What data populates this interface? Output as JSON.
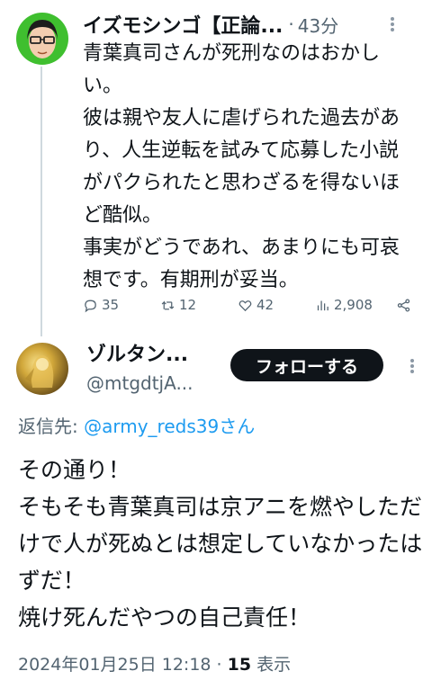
{
  "tweet1": {
    "author_name": "イズモシンゴ【正論...",
    "separator": "·",
    "time": "43分",
    "body": "青葉真司さんが死刑なのはおかしい。\n彼は親や友人に虐げられた過去があり、人生逆転を試みて応募した小説がパクられたと思わざるを得ないほど酷似。\n事実がどうであれ、あまりにも可哀想です。有期刑が妥当。",
    "replies": "35",
    "reposts": "12",
    "likes": "42",
    "views": "2,908"
  },
  "tweet2": {
    "author_name": "ゾルタン...",
    "handle": "@mtgdtjA...",
    "follow_label": "フォローする",
    "reply_prefix": "返信先: ",
    "reply_mention": "@army_reds39さん",
    "body": "その通り！\nそもそも青葉真司は京アニを燃やしただけで人が死ぬとは想定していなかったはずだ！\n焼け死んだやつの自己責任！",
    "date": "2024年01月25日 12:18",
    "separator": " · ",
    "views_count": "15",
    "views_label": " 表示"
  },
  "icons": {
    "reply": "reply-icon",
    "repost": "repost-icon",
    "like": "heart-icon",
    "views": "views-icon",
    "share": "share-icon",
    "more": "more-icon"
  },
  "colors": {
    "text": "#0f1419",
    "secondary": "#536471",
    "link": "#1d9bf0",
    "follow_button": "#0f1419",
    "thread_line": "#cfd9de"
  }
}
